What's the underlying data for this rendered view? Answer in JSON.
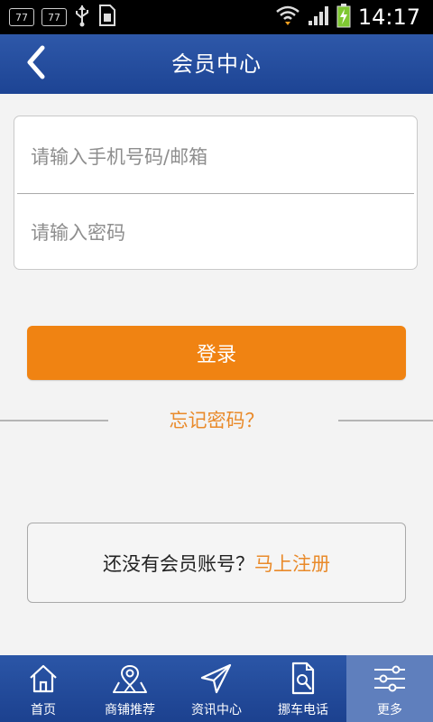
{
  "status_bar": {
    "left_badges": [
      "77",
      "77"
    ],
    "time": "14:17"
  },
  "header": {
    "title": "会员中心",
    "back_icon": "chevron-left-icon"
  },
  "login": {
    "username_placeholder": "请输入手机号码/邮箱",
    "password_placeholder": "请输入密码",
    "login_button": "登录",
    "forgot_password": "忘记密码？"
  },
  "register": {
    "question": "还没有会员账号？",
    "link": "马上注册"
  },
  "bottom_nav": {
    "items": [
      {
        "label": "首页",
        "icon": "home-icon"
      },
      {
        "label": "商铺推荐",
        "icon": "map-pin-icon"
      },
      {
        "label": "资讯中心",
        "icon": "send-icon"
      },
      {
        "label": "挪车电话",
        "icon": "document-search-icon"
      },
      {
        "label": "更多",
        "icon": "sliders-icon"
      }
    ],
    "active_index": 4
  },
  "colors": {
    "header": "#2449a0",
    "accent": "#f08312",
    "link": "#e98a2a"
  }
}
